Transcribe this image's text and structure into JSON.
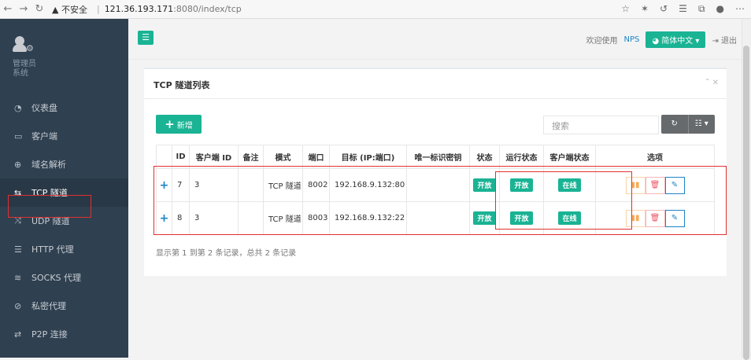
{
  "browser": {
    "security": "▲ 不安全",
    "host": "121.36.193.171",
    "path": ":8080/index/tcp"
  },
  "sidebar": {
    "profile_name": "管理员",
    "profile_role": "系统",
    "items": [
      {
        "label": "仪表盘",
        "icon": "dashboard-icon",
        "glyph": "◔"
      },
      {
        "label": "客户端",
        "icon": "monitor-icon",
        "glyph": "▭"
      },
      {
        "label": "域名解析",
        "icon": "globe-icon",
        "glyph": "⊕"
      },
      {
        "label": "TCP 隧道",
        "icon": "exchange-icon",
        "glyph": "⇆"
      },
      {
        "label": "UDP 隧道",
        "icon": "shuffle-icon",
        "glyph": "⤨"
      },
      {
        "label": "HTTP 代理",
        "icon": "server-icon",
        "glyph": "☰"
      },
      {
        "label": "SOCKS 代理",
        "icon": "layers-icon",
        "glyph": "≋"
      },
      {
        "label": "私密代理",
        "icon": "eye-slash-icon",
        "glyph": "⊘"
      },
      {
        "label": "P2P 连接",
        "icon": "arrows-icon",
        "glyph": "⇄"
      }
    ]
  },
  "topbar": {
    "menu_icon": "hamburger-icon",
    "welcome": "欢迎使用",
    "brand": "NPS",
    "lang_button": "◕ 简体中文 ▾",
    "logout": "⇥ 退出"
  },
  "panel": {
    "title": "TCP 隧道列表",
    "tools": "ˆ ✕",
    "add_button": "新增",
    "search_placeholder": "搜索",
    "refresh_icon": "↻",
    "columns_icon": "☷ ▾",
    "footer": "显示第 1 到第 2 条记录，总共 2 条记录"
  },
  "table": {
    "headers": [
      "",
      "ID",
      "客户端 ID",
      "备注",
      "模式",
      "端口",
      "目标 (IP:端口)",
      "唯一标识密钥",
      "状态",
      "运行状态",
      "客户端状态",
      "选项"
    ],
    "rows": [
      {
        "expand": "+",
        "id": "7",
        "client_id": "3",
        "remark": "",
        "mode": "TCP 隧道",
        "port": "8002",
        "target": "192.168.9.132:80",
        "key": "",
        "status": "开放",
        "run_status": "开放",
        "client_status": "在线"
      },
      {
        "expand": "+",
        "id": "8",
        "client_id": "3",
        "remark": "",
        "mode": "TCP 隧道",
        "port": "8003",
        "target": "192.168.9.132:22",
        "key": "",
        "status": "开放",
        "run_status": "开放",
        "client_status": "在线"
      }
    ],
    "op_icons": {
      "pause": "▮▮",
      "delete": "🗑",
      "edit": "✎"
    }
  },
  "colors": {
    "accent": "#1ab394",
    "sidebar": "#2f4050",
    "link": "#1c84c6",
    "highlight": "#e03030"
  }
}
